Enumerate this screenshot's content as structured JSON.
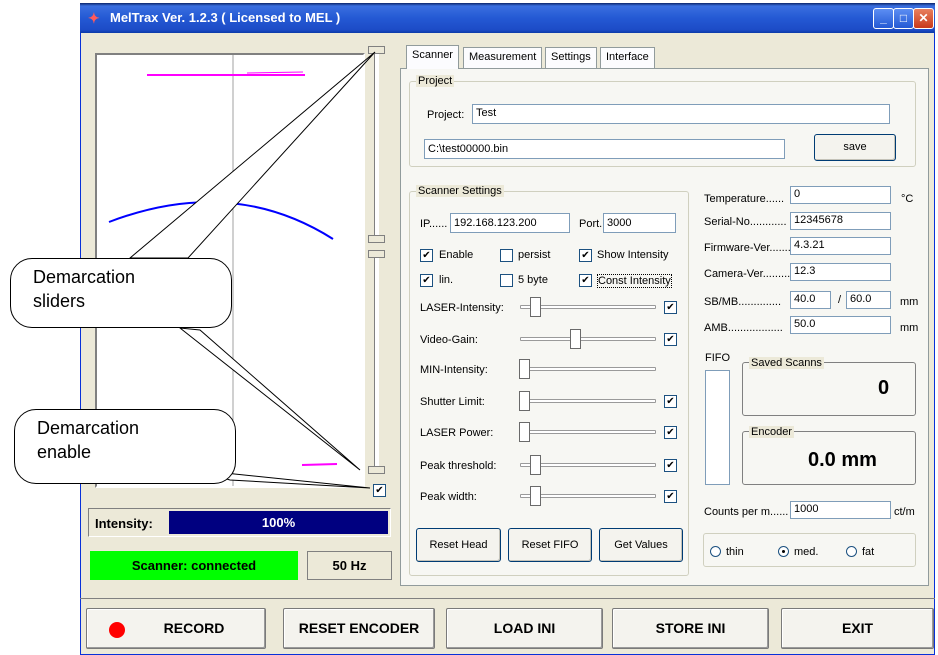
{
  "window": {
    "title": "MelTrax   Ver. 1.2.3  ( Licensed to MEL )",
    "minimize_label": "_",
    "maximize_label": "□",
    "close_label": "✕"
  },
  "left_panel": {
    "intensity_label": "Intensity:",
    "intensity_value": "100%",
    "intensity_level": 1.0,
    "scanner_status": "Scanner: connected",
    "scanner_status_color": "#00ff00",
    "frequency": "50 Hz",
    "demarcation_enable_checked": true
  },
  "callouts": {
    "sliders": "Demarcation sliders",
    "enable": "Demarcation enable"
  },
  "tabs": [
    "Scanner",
    "Measurement",
    "Settings",
    "Interface"
  ],
  "active_tab": "Scanner",
  "project": {
    "group_title": "Project",
    "project_label": "Project:",
    "project_value": "Test",
    "file_path": "C:\\test00000.bin",
    "save_label": "save"
  },
  "scanner_settings": {
    "group_title": "Scanner Settings",
    "ip_label": "IP......",
    "ip_value": "192.168.123.200",
    "port_label": "Port.",
    "port_value": "3000",
    "checkboxes": [
      {
        "label": "Enable",
        "checked": true
      },
      {
        "label": "persist",
        "checked": false
      },
      {
        "label": "Show Intensity",
        "checked": true
      },
      {
        "label": "lin.",
        "checked": true
      },
      {
        "label": "5 byte",
        "checked": false
      },
      {
        "label": "Const Intensity",
        "checked": true
      }
    ],
    "sliders": [
      {
        "label": "LASER-Intensity:",
        "checked": true
      },
      {
        "label": "Video-Gain:",
        "checked": true
      },
      {
        "label": "MIN-Intensity:"
      },
      {
        "label": "Shutter Limit:",
        "checked": true
      },
      {
        "label": "LASER Power:",
        "checked": true
      },
      {
        "label": "Peak threshold:",
        "checked": true
      },
      {
        "label": "Peak width:",
        "checked": true
      }
    ],
    "reset_head_label": "Reset Head",
    "reset_fifo_label": "Reset FIFO",
    "get_values_label": "Get Values"
  },
  "device_info": {
    "temperature_label": "Temperature......",
    "temperature_value": "0",
    "temperature_unit": "°C",
    "serial_label": "Serial-No............",
    "serial_value": "12345678",
    "firmware_label": "Firmware-Ver........",
    "firmware_value": "4.3.21",
    "camera_label": "Camera-Ver..........",
    "camera_value": "12.3",
    "sbmb_label": "SB/MB..............",
    "sb_value": "40.0",
    "sbmb_sep": "/",
    "mb_value": "60.0",
    "sbmb_unit": "mm",
    "amb_label": "AMB..................",
    "amb_value": "50.0",
    "amb_unit": "mm"
  },
  "fifo_label": "FIFO",
  "saved_scans": {
    "title": "Saved Scanns",
    "value": "0"
  },
  "encoder": {
    "title": "Encoder",
    "value": "0.0 mm"
  },
  "counts": {
    "label": "Counts per m......",
    "value": "1000",
    "unit": "ct/m"
  },
  "thickness": {
    "options": [
      "thin",
      "med.",
      "fat"
    ],
    "selected": "med."
  },
  "bottom_buttons": {
    "record": "RECORD",
    "reset_encoder": "RESET ENCODER",
    "load_ini": "LOAD INI",
    "store_ini": "STORE INI",
    "exit": "EXIT"
  },
  "colors": {
    "title_bar": "#2459d4",
    "intensity_bar": "#000080",
    "plot_magenta": "#ff00ff",
    "plot_blue": "#0000ff",
    "record_dot": "#ff0000"
  }
}
